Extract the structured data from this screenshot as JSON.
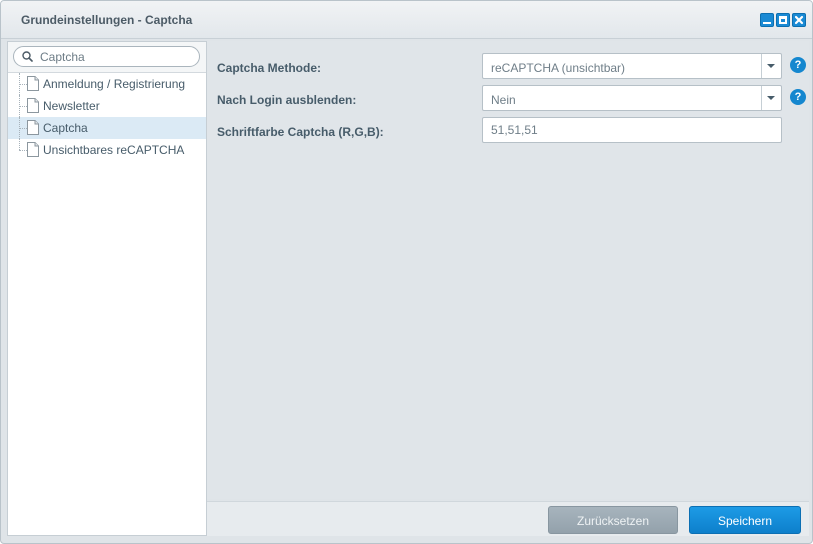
{
  "window": {
    "title": "Grundeinstellungen - Captcha",
    "controls": [
      "minimize-icon",
      "maximize-icon",
      "close-icon"
    ]
  },
  "sidebar": {
    "search": {
      "placeholder": "Captcha",
      "value": ""
    },
    "items": [
      {
        "label": "Anmeldung / Registrierung",
        "icon": "document-icon",
        "selected": false
      },
      {
        "label": "Newsletter",
        "icon": "document-icon",
        "selected": false
      },
      {
        "label": "Captcha",
        "icon": "document-icon",
        "selected": true
      },
      {
        "label": "Unsichtbares reCAPTCHA",
        "icon": "document-icon",
        "selected": false
      }
    ]
  },
  "form": {
    "captcha_method": {
      "label": "Captcha Methode:",
      "value": "reCAPTCHA (unsichtbar)",
      "help": "?"
    },
    "hide_after_login": {
      "label": "Nach Login ausblenden:",
      "value": "Nein",
      "help": "?"
    },
    "font_color": {
      "label": "Schriftfarbe Captcha (R,G,B):",
      "value": "51,51,51"
    }
  },
  "footer": {
    "reset_label": "Zurücksetzen",
    "save_label": "Speichern"
  },
  "colors": {
    "accent": "#1587cf",
    "selected_row": "#dbeaf5",
    "reset_button": "#9aa7b1"
  }
}
